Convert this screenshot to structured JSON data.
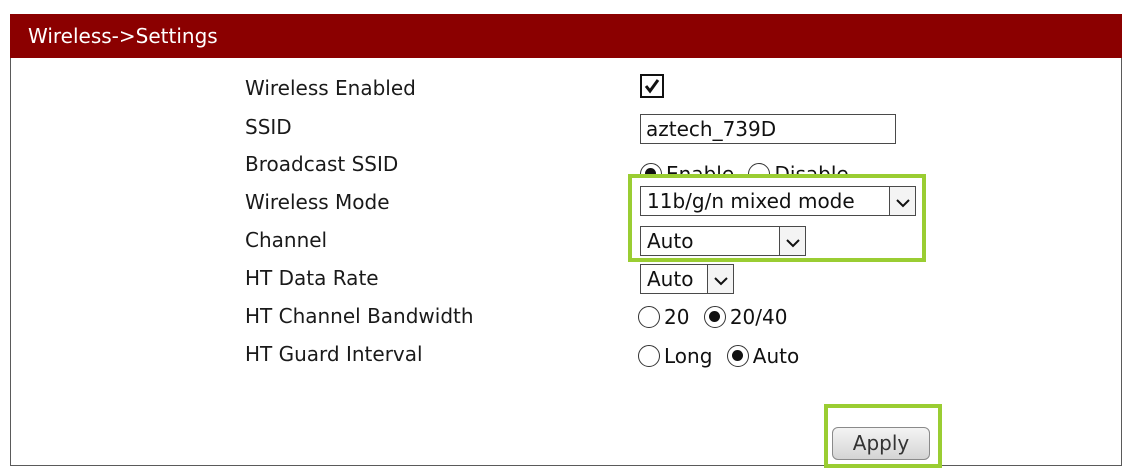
{
  "header": {
    "title": "Wireless->Settings"
  },
  "form": {
    "wireless_enabled": {
      "label": "Wireless Enabled",
      "checked": true
    },
    "ssid": {
      "label": "SSID",
      "value": "aztech_739D"
    },
    "broadcast_ssid": {
      "label": "Broadcast SSID",
      "options": [
        "Enable",
        "Disable"
      ],
      "selected": "Enable"
    },
    "wireless_mode": {
      "label": "Wireless Mode",
      "value": "11b/g/n mixed mode"
    },
    "channel": {
      "label": "Channel",
      "value": "Auto"
    },
    "ht_data_rate": {
      "label": "HT Data Rate",
      "value": "Auto"
    },
    "ht_channel_bandwidth": {
      "label": "HT Channel Bandwidth",
      "options": [
        "20",
        "20/40"
      ],
      "selected": "20/40"
    },
    "ht_guard_interval": {
      "label": "HT Guard Interval",
      "options": [
        "Long",
        "Auto"
      ],
      "selected": "Auto"
    }
  },
  "actions": {
    "apply_label": "Apply"
  },
  "colors": {
    "header_bg": "#8b0000",
    "highlight": "#9acd32"
  }
}
